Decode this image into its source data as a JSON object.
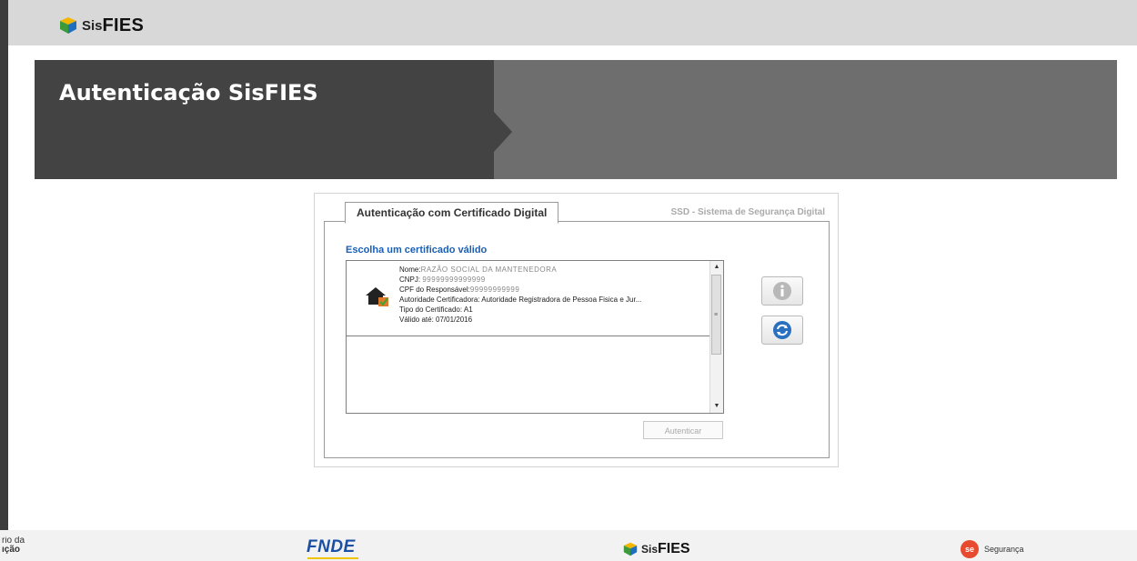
{
  "header": {
    "logo_sis": "Sis",
    "logo_fies": "FIES"
  },
  "banner": {
    "title": "Autenticação SisFIES"
  },
  "panel": {
    "tab_label": "Autenticação com Certificado Digital",
    "system_label": "SSD - Sistema de Segurança Digital",
    "choose_label": "Escolha um certificado válido",
    "certificates": [
      {
        "nome_label": "Nome:",
        "nome_value": "RAZÃO SOCIAL DA MANTENEDORA",
        "cnpj_label": "CNPJ:",
        "cnpj_value": "99999999999999",
        "cpf_label": "CPF do Responsável:",
        "cpf_value": "99999999999",
        "autoridade": "Autoridade Certificadora: Autoridade Registradora de Pessoa Fisica e Jur...",
        "tipo": "Tipo do Certificado: A1",
        "validade": "Válido até: 07/01/2016"
      }
    ],
    "info_icon": "info-icon",
    "refresh_icon": "refresh-icon",
    "auth_button": "Autenticar"
  },
  "footer": {
    "ministry_line1": "rio da",
    "ministry_line2": "ıção",
    "fnde": "FNDE",
    "logo_sis": "Sis",
    "logo_fies": "FIES",
    "seg_badge": "se",
    "seg_label": "Segurança"
  },
  "colors": {
    "banner_dark": "#434343",
    "banner_light": "#6e6e6e",
    "link_blue": "#1a5fb4",
    "seg_red": "#e84a2f",
    "fnde_blue": "#1b4fa3"
  }
}
